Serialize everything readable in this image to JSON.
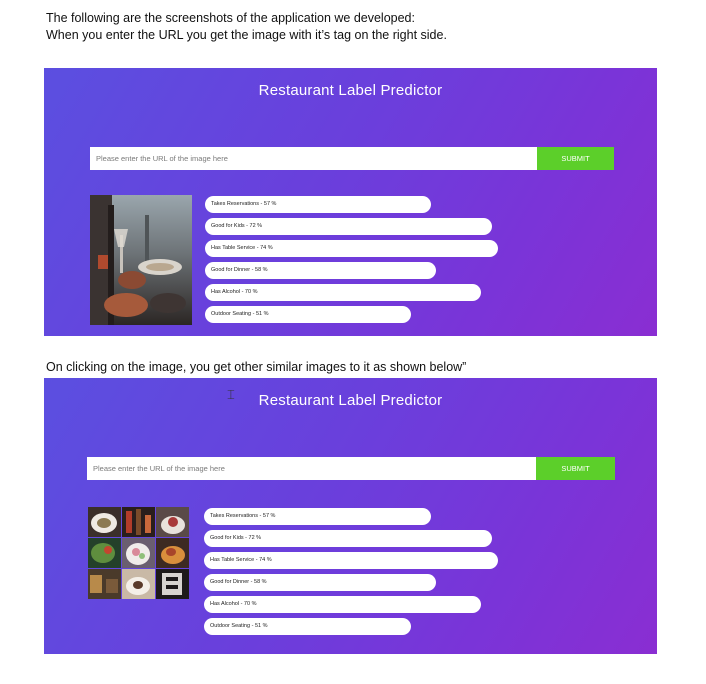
{
  "document": {
    "intro_line_1": "The following are the screenshots of the application we developed:",
    "intro_line_2": "When you enter the URL you get the image with it’s tag on the right side.",
    "between_text": "On clicking on the image, you get other similar images to it as shown below”"
  },
  "app": {
    "title": "Restaurant Label Predictor",
    "url_placeholder": "Please enter the URL of the image here",
    "submit_label": "SUBMIT",
    "accent_colors": {
      "panel_start": "#5b4fe0",
      "panel_end": "#8a2ed2",
      "submit": "#5ccf2a"
    }
  },
  "labels": [
    {
      "text": "Takes Reservations - 57 %",
      "percent": 57
    },
    {
      "text": "Good for Kids - 72 %",
      "percent": 72
    },
    {
      "text": "Has Table Service - 74 %",
      "percent": 74
    },
    {
      "text": "Good for Dinner - 58 %",
      "percent": 58
    },
    {
      "text": "Has Alcohol - 70 %",
      "percent": 70
    },
    {
      "text": "Outdoor Seating - 51 %",
      "percent": 51
    }
  ]
}
